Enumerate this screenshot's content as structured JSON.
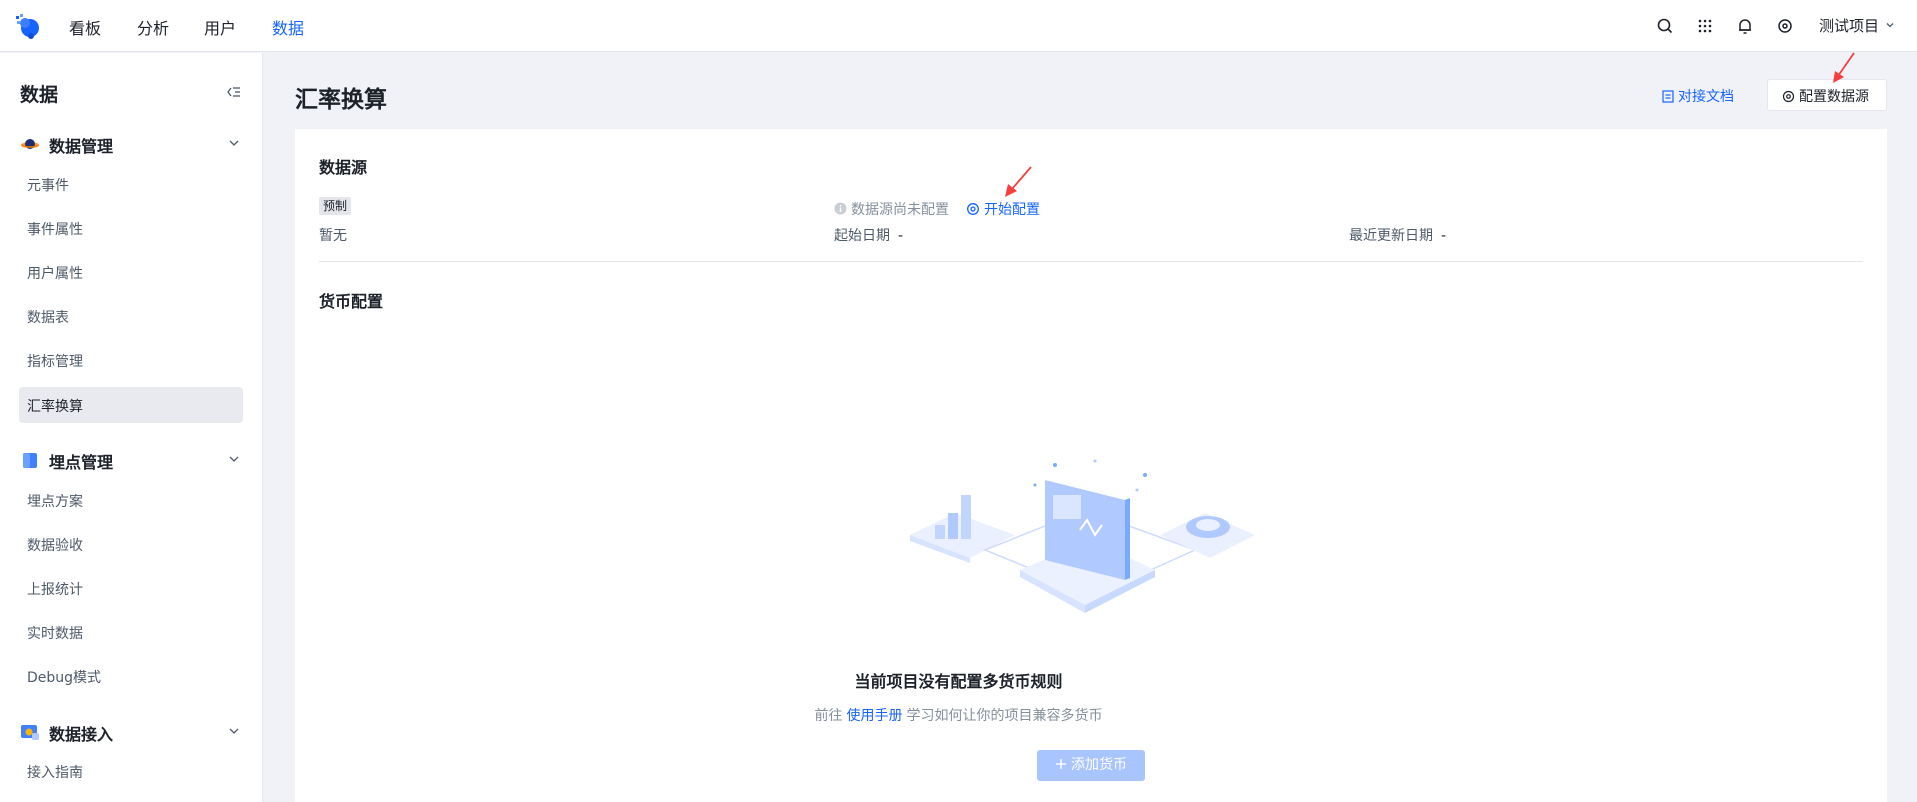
{
  "topnav": {
    "items": [
      {
        "label": "看板",
        "active": false
      },
      {
        "label": "分析",
        "active": false
      },
      {
        "label": "用户",
        "active": false
      },
      {
        "label": "数据",
        "active": true
      }
    ],
    "project": "测试项目",
    "icons": [
      "search-icon",
      "apps-grid-icon",
      "bell-icon",
      "settings-icon"
    ]
  },
  "sidebar": {
    "title": "数据",
    "groups": [
      {
        "label": "数据管理",
        "icon": "planet-icon",
        "items": [
          "元事件",
          "事件属性",
          "用户属性",
          "数据表",
          "指标管理",
          "汇率换算"
        ]
      },
      {
        "label": "埋点管理",
        "icon": "cube-icon",
        "items": [
          "埋点方案",
          "数据验收",
          "上报统计",
          "实时数据",
          "Debug模式"
        ]
      },
      {
        "label": "数据接入",
        "icon": "data-access-icon",
        "items": [
          "接入指南"
        ]
      }
    ],
    "active_item": "汇率换算"
  },
  "main": {
    "title": "汇率换算",
    "doc_link": "对接文档",
    "config_button": "配置数据源",
    "datasource": {
      "section_title": "数据源",
      "tag": "预制",
      "empty": "暂无",
      "status": "数据源尚未配置",
      "start_link": "开始配置",
      "start_date_label": "起始日期",
      "start_date_value": "-",
      "updated_label": "最近更新日期",
      "updated_value": "-"
    },
    "currency": {
      "section_title": "货币配置",
      "empty_title": "当前项目没有配置多货币规则",
      "empty_prefix": "前往",
      "empty_link": "使用手册",
      "empty_suffix": "学习如何让你的项目兼容多货币",
      "add_button": "添加货币"
    }
  },
  "colors": {
    "accent": "#1664ff",
    "annotation_arrow": "#f53f3f",
    "disabled_button": "#a8c5ff"
  }
}
